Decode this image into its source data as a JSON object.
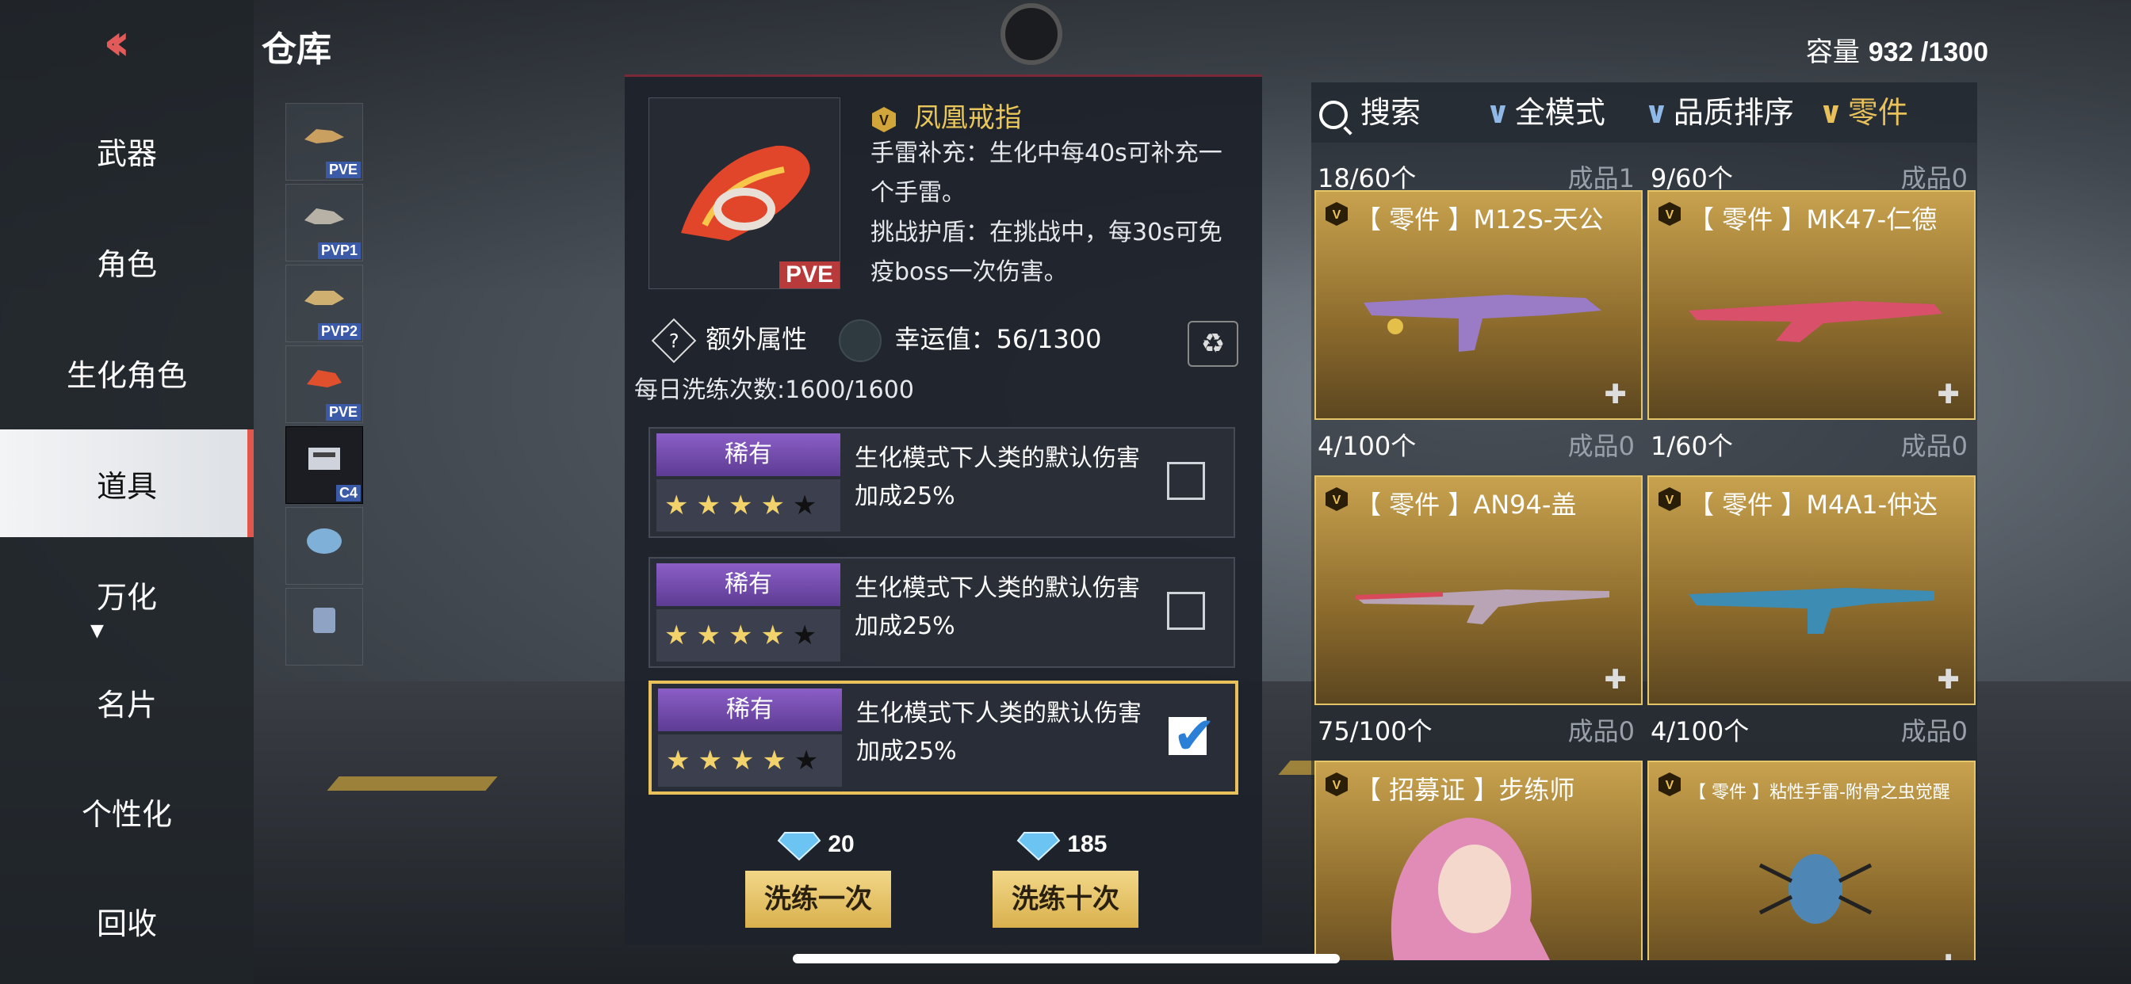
{
  "header": {
    "title": "仓库",
    "capacity_label": "容量",
    "capacity_value": "932 /1300"
  },
  "nav": {
    "items": [
      {
        "label": "武器"
      },
      {
        "label": "角色"
      },
      {
        "label": "生化角色"
      },
      {
        "label": "道具"
      },
      {
        "label": "万化"
      },
      {
        "label": "名片"
      },
      {
        "label": "个性化"
      },
      {
        "label": "回收"
      }
    ],
    "active_index": 3
  },
  "thumbs": [
    {
      "tag": "PVE"
    },
    {
      "tag": "PVP1"
    },
    {
      "tag": "PVP2"
    },
    {
      "tag": "PVE"
    },
    {
      "tag": "C4"
    },
    {
      "tag": ""
    },
    {
      "tag": ""
    }
  ],
  "item": {
    "name": "凤凰戒指",
    "badge": "PVE",
    "desc1": "手雷补充：生化中每40s可补充一个手雷。",
    "desc2": "挑战护盾：在挑战中，每30s可免疫boss一次伤害。",
    "extra_label": "额外属性",
    "luck_label": "幸运值：56/1300",
    "daily_label": "每日洗练次数:1600/1600"
  },
  "attributes": [
    {
      "rarity": "稀有",
      "stars": 4,
      "text": "生化模式下人类的默认伤害加成25%",
      "checked": false
    },
    {
      "rarity": "稀有",
      "stars": 4,
      "text": "生化模式下人类的默认伤害加成25%",
      "checked": false
    },
    {
      "rarity": "稀有",
      "stars": 4,
      "text": "生化模式下人类的默认伤害加成25%",
      "checked": true
    }
  ],
  "refine": {
    "once_cost": "20",
    "once_label": "洗练一次",
    "ten_cost": "185",
    "ten_label": "洗练十次"
  },
  "filters": {
    "search": "搜索",
    "mode": "全模式",
    "sort": "品质排序",
    "category": "零件"
  },
  "cards": [
    {
      "count": "18/60个",
      "made": "成品1",
      "name": "【 零件 】M12S-天公"
    },
    {
      "count": "9/60个",
      "made": "成品0",
      "name": "【 零件 】MK47-仁德"
    },
    {
      "count": "4/100个",
      "made": "成品0",
      "name": "【 零件 】AN94-盖"
    },
    {
      "count": "1/60个",
      "made": "成品0",
      "name": "【 零件 】M4A1-仲达"
    },
    {
      "count": "75/100个",
      "made": "成品0",
      "name": "【 招募证 】步练师"
    },
    {
      "count": "4/100个",
      "made": "成品0",
      "name": "【 零件 】粘性手雷-附骨之虫觉醒"
    }
  ],
  "colors": {
    "accent": "#e9c15a",
    "rarity_purple": "#7a52b6",
    "back_red": "#e35a5a"
  }
}
